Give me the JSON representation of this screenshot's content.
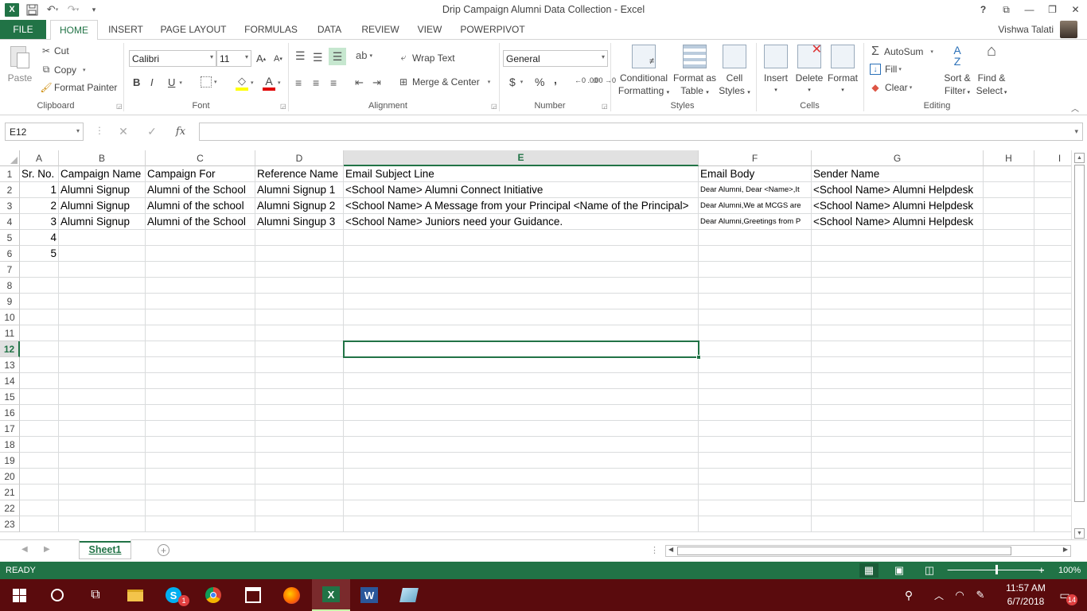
{
  "window": {
    "title": "Drip Campaign Alumni Data Collection - Excel",
    "help": "?",
    "user_name": "Vishwa Talati"
  },
  "tabs": {
    "file": "FILE",
    "items": [
      "HOME",
      "INSERT",
      "PAGE LAYOUT",
      "FORMULAS",
      "DATA",
      "REVIEW",
      "VIEW",
      "POWERPIVOT"
    ],
    "active": "HOME"
  },
  "ribbon": {
    "clipboard": {
      "paste": "Paste",
      "cut": "Cut",
      "copy": "Copy",
      "format_painter": "Format Painter",
      "label": "Clipboard"
    },
    "font": {
      "name": "Calibri",
      "size": "11",
      "bold": "B",
      "italic": "I",
      "underline": "U",
      "label": "Font"
    },
    "alignment": {
      "wrap_text": "Wrap Text",
      "merge_center": "Merge & Center",
      "label": "Alignment"
    },
    "number": {
      "format": "General",
      "currency": "$",
      "percent": "%",
      "comma": ",",
      "label": "Number"
    },
    "styles": {
      "conditional_1": "Conditional",
      "conditional_2": "Formatting",
      "format_table_1": "Format as",
      "format_table_2": "Table",
      "cell_styles_1": "Cell",
      "cell_styles_2": "Styles",
      "label": "Styles"
    },
    "cells": {
      "insert": "Insert",
      "delete": "Delete",
      "format": "Format",
      "label": "Cells"
    },
    "editing": {
      "autosum": "AutoSum",
      "fill": "Fill",
      "clear": "Clear",
      "sort_1": "Sort &",
      "sort_2": "Filter",
      "find_1": "Find &",
      "find_2": "Select",
      "label": "Editing"
    }
  },
  "formula_bar": {
    "name_box": "E12",
    "fx": "fx",
    "cancel": "✕",
    "enter": "✓",
    "value": ""
  },
  "sheet": {
    "columns": [
      "A",
      "B",
      "C",
      "D",
      "E",
      "F",
      "G",
      "H",
      "I"
    ],
    "selected_column": "E",
    "selected_row": "12",
    "row_numbers": [
      "1",
      "2",
      "3",
      "4",
      "5",
      "6",
      "7",
      "8",
      "9",
      "10",
      "11",
      "12",
      "13",
      "14",
      "15",
      "16",
      "17",
      "18",
      "19",
      "20",
      "21",
      "22",
      "23"
    ],
    "rows": [
      [
        "Sr. No.",
        "Campaign Name",
        "Campaign For",
        "Reference Name",
        "Email Subject Line",
        "Email Body",
        "Sender Name",
        "",
        ""
      ],
      [
        "1",
        "Alumni Signup",
        "Alumni of the School",
        "Alumni Signup 1",
        "<School Name> Alumni Connect Initiative",
        "Dear Alumni, Dear <Name>,It",
        "<School Name> Alumni Helpdesk",
        "",
        ""
      ],
      [
        "2",
        "Alumni Signup",
        "Alumni of the school",
        "Alumni Signup 2",
        "<School Name> A Message from your Principal <Name of the Principal>",
        "Dear Alumni,We at MCGS are",
        "<School Name> Alumni Helpdesk",
        "",
        ""
      ],
      [
        "3",
        "Alumni Signup",
        "Alumni of the School",
        "Alumni Singup 3",
        "<School Name> Juniors need your Guidance.",
        "Dear Alumni,Greetings from P",
        "<School Name> Alumni Helpdesk",
        "",
        ""
      ],
      [
        "4",
        "",
        "",
        "",
        "",
        "",
        "",
        "",
        ""
      ],
      [
        "5",
        "",
        "",
        "",
        "",
        "",
        "",
        "",
        ""
      ]
    ]
  },
  "sheet_tabs": {
    "active": "Sheet1",
    "add": "+"
  },
  "status": {
    "ready": "READY",
    "zoom": "100%",
    "zoom_minus": "−",
    "zoom_plus": "+"
  },
  "taskbar": {
    "time": "11:57 AM",
    "date": "6/7/2018",
    "notifications": "14",
    "skype_badge": "1"
  }
}
